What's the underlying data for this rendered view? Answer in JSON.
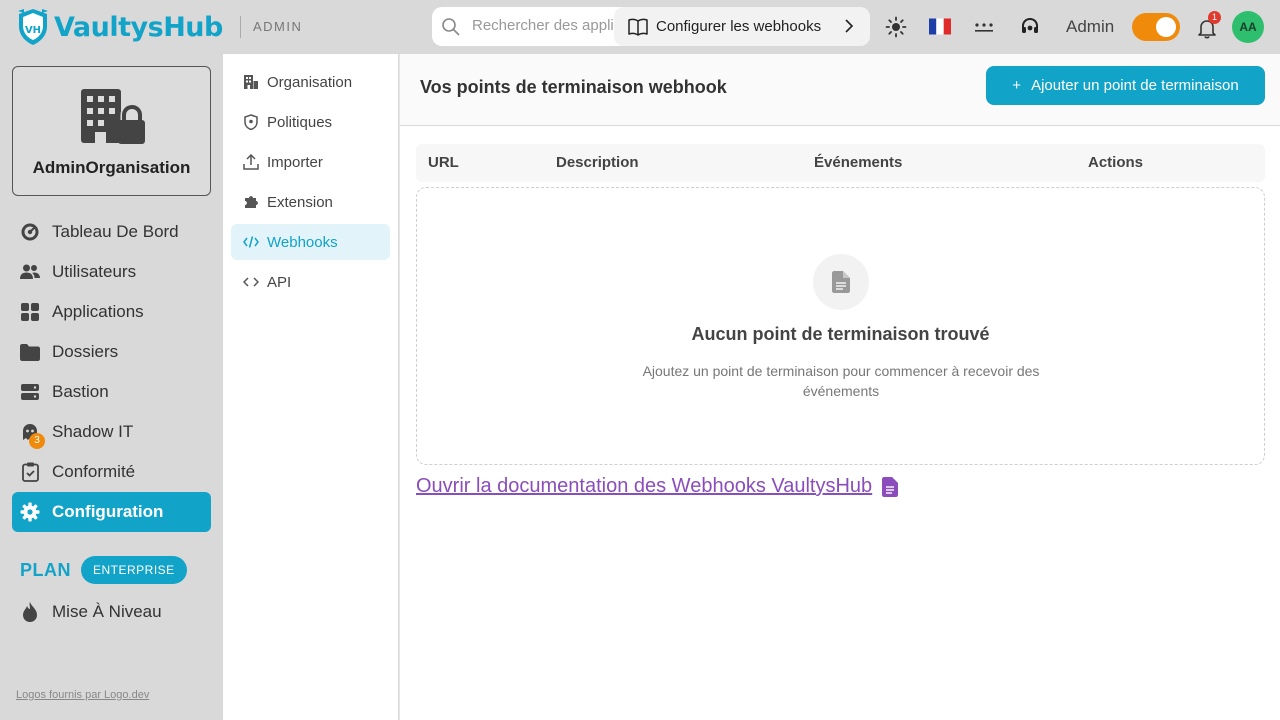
{
  "app": {
    "name": "VaultysHub",
    "section_tag": "ADMIN"
  },
  "topbar": {
    "search_placeholder": "Rechercher des applications",
    "guide_label": "Configurer les webhooks",
    "user_name": "Admin",
    "notification_count": "1",
    "avatar_initials": "AA",
    "language_flag": "fr"
  },
  "org": {
    "name": "AdminOrganisation"
  },
  "sidebar": {
    "items": [
      {
        "label": "Tableau De Bord"
      },
      {
        "label": "Utilisateurs"
      },
      {
        "label": "Applications"
      },
      {
        "label": "Dossiers"
      },
      {
        "label": "Bastion"
      },
      {
        "label": "Shadow IT",
        "badge": "3"
      },
      {
        "label": "Conformité"
      },
      {
        "label": "Configuration"
      }
    ],
    "plan_label": "PLAN",
    "plan_badge": "ENTERPRISE",
    "upgrade_label": "Mise À Niveau",
    "logos_credit": "Logos fournis par Logo.dev"
  },
  "subnav": {
    "items": [
      {
        "label": "Organisation"
      },
      {
        "label": "Politiques"
      },
      {
        "label": "Importer"
      },
      {
        "label": "Extension"
      },
      {
        "label": "Webhooks"
      },
      {
        "label": "API"
      }
    ]
  },
  "main": {
    "title": "Vos points de terminaison webhook",
    "add_button": "Ajouter un point de terminaison",
    "columns": [
      "URL",
      "Description",
      "Événements",
      "Actions"
    ],
    "empty_title": "Aucun point de terminaison trouvé",
    "empty_desc": "Ajoutez un point de terminaison pour commencer à recevoir des événements",
    "doc_link": "Ouvrir la documentation des Webhooks VaultysHub"
  },
  "colors": {
    "accent": "#12a3c9",
    "toggle": "#f08a0b",
    "link": "#8a4dbb"
  }
}
